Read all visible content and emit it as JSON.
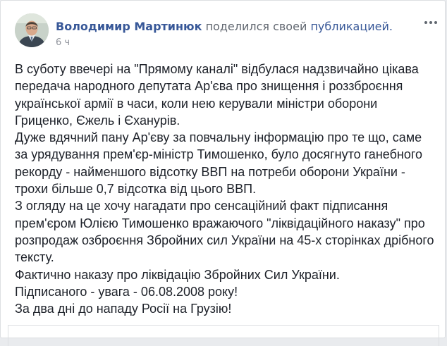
{
  "post": {
    "author": "Володимир Мартинюк",
    "action": "поделился своей",
    "shared_link": "публикацией.",
    "time": "6 ч",
    "paragraphs": [
      "В суботу ввечері на \"Прямому каналі\" відбулася надзвичайно цікава передача народного депутата Ар'єва про знищення і роззброєння української армії в часи, коли нею керували міністри оборони Гриценко, Єжель і Єханурів.",
      "Дуже вдячний пану Ар'єву за повчальну інформацію про те що, саме за урядування прем'єр-міністр Тимошенко, було досягнуто ганебного рекорду - найменшого відсотку ВВП на потреби оборони України - трохи більше 0,7 відсотка від цього ВВП.",
      "З огляду на це хочу нагадати про сенсаційний факт підписання прем'єром Юлією Тимошенко вражаючого \"ліквідаційного наказу\" про розпродаж озброєння Збройних сил України на 45-х сторінках дрібного тексту.",
      "Фактично наказу про ліквідацію Збройних Сил України.",
      "Підписаного - увага - 06.08.2008 року!",
      "За два дні до нападу Росії на Грузію!"
    ]
  },
  "icons": {
    "menu": "more-horizontal-icon",
    "avatar": "profile-photo"
  },
  "colors": {
    "link": "#385898",
    "text": "#1d2129",
    "muted": "#90949c",
    "action": "#616770"
  }
}
